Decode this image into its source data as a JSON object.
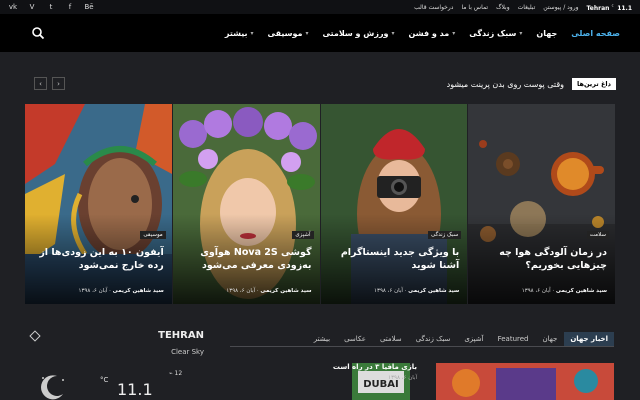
{
  "topbar": {
    "socials": [
      "vk",
      "vimeo",
      "twitter",
      "facebook",
      "behance"
    ],
    "social_glyphs": [
      "vk",
      "V",
      "t",
      "f",
      "Bē"
    ],
    "weather_brand": "Tehran",
    "temp": "11.1",
    "links": [
      "ورود / پیوستن",
      "تبلیغات",
      "وبلاگ",
      "تماس با ما",
      "درخواست قالب"
    ]
  },
  "nav": {
    "items": [
      {
        "label": "صفحه اصلی",
        "active": true,
        "dropdown": false
      },
      {
        "label": "جهان",
        "active": false,
        "dropdown": false
      },
      {
        "label": "سبک زندگی",
        "active": false,
        "dropdown": true
      },
      {
        "label": "مد و فشن",
        "active": false,
        "dropdown": true
      },
      {
        "label": "ورزش و سلامتی",
        "active": false,
        "dropdown": true
      },
      {
        "label": "موسیقی",
        "active": false,
        "dropdown": true
      },
      {
        "label": "بیشتر",
        "active": false,
        "dropdown": true
      }
    ]
  },
  "trending": {
    "tag": "داغ ترین‌ها",
    "text": "وقتی پوست روی بدن پرینت میشود"
  },
  "cards": [
    {
      "category": "سلامت",
      "title": "در زمان آلودگی هوا چه چیزهایی بخوریم؟",
      "author": "سید شاهین کریمی",
      "date": "آبان ۶، ۱۳۹۸"
    },
    {
      "category": "سبک زندگی",
      "title": "با ویژگی جدید اینستاگرام آشنا شوید",
      "author": "سید شاهین کریمی",
      "date": "آبان ۶، ۱۳۹۸"
    },
    {
      "category": "آشپزی",
      "title": "گوشی Nova 2S هوآوی به‌زودی معرفی می‌شود",
      "author": "سید شاهین کریمی",
      "date": "آبان ۶، ۱۳۹۸"
    },
    {
      "category": "موسیقی",
      "title": "آیفون ۱۰ به این زودی‌ها از رده خارج نمی‌شود",
      "author": "سید شاهین کریمی",
      "date": "آبان ۶، ۱۳۹۸"
    }
  ],
  "weather": {
    "city": "TEHRAN",
    "condition": "Clear Sky",
    "temp": "11.1",
    "unit": "C",
    "wind": "12"
  },
  "tabs": [
    "اخبار جهان",
    "جهان",
    "Featured",
    "آشپزی",
    "سبک زندگی",
    "سلامتی",
    "عکاسی",
    "بیشتر"
  ],
  "mini": {
    "title": "بازی مافیا ۳ در راه است",
    "date": "آبان ۶، ۱۳۹۸",
    "thumb_text": "DUBAI"
  }
}
